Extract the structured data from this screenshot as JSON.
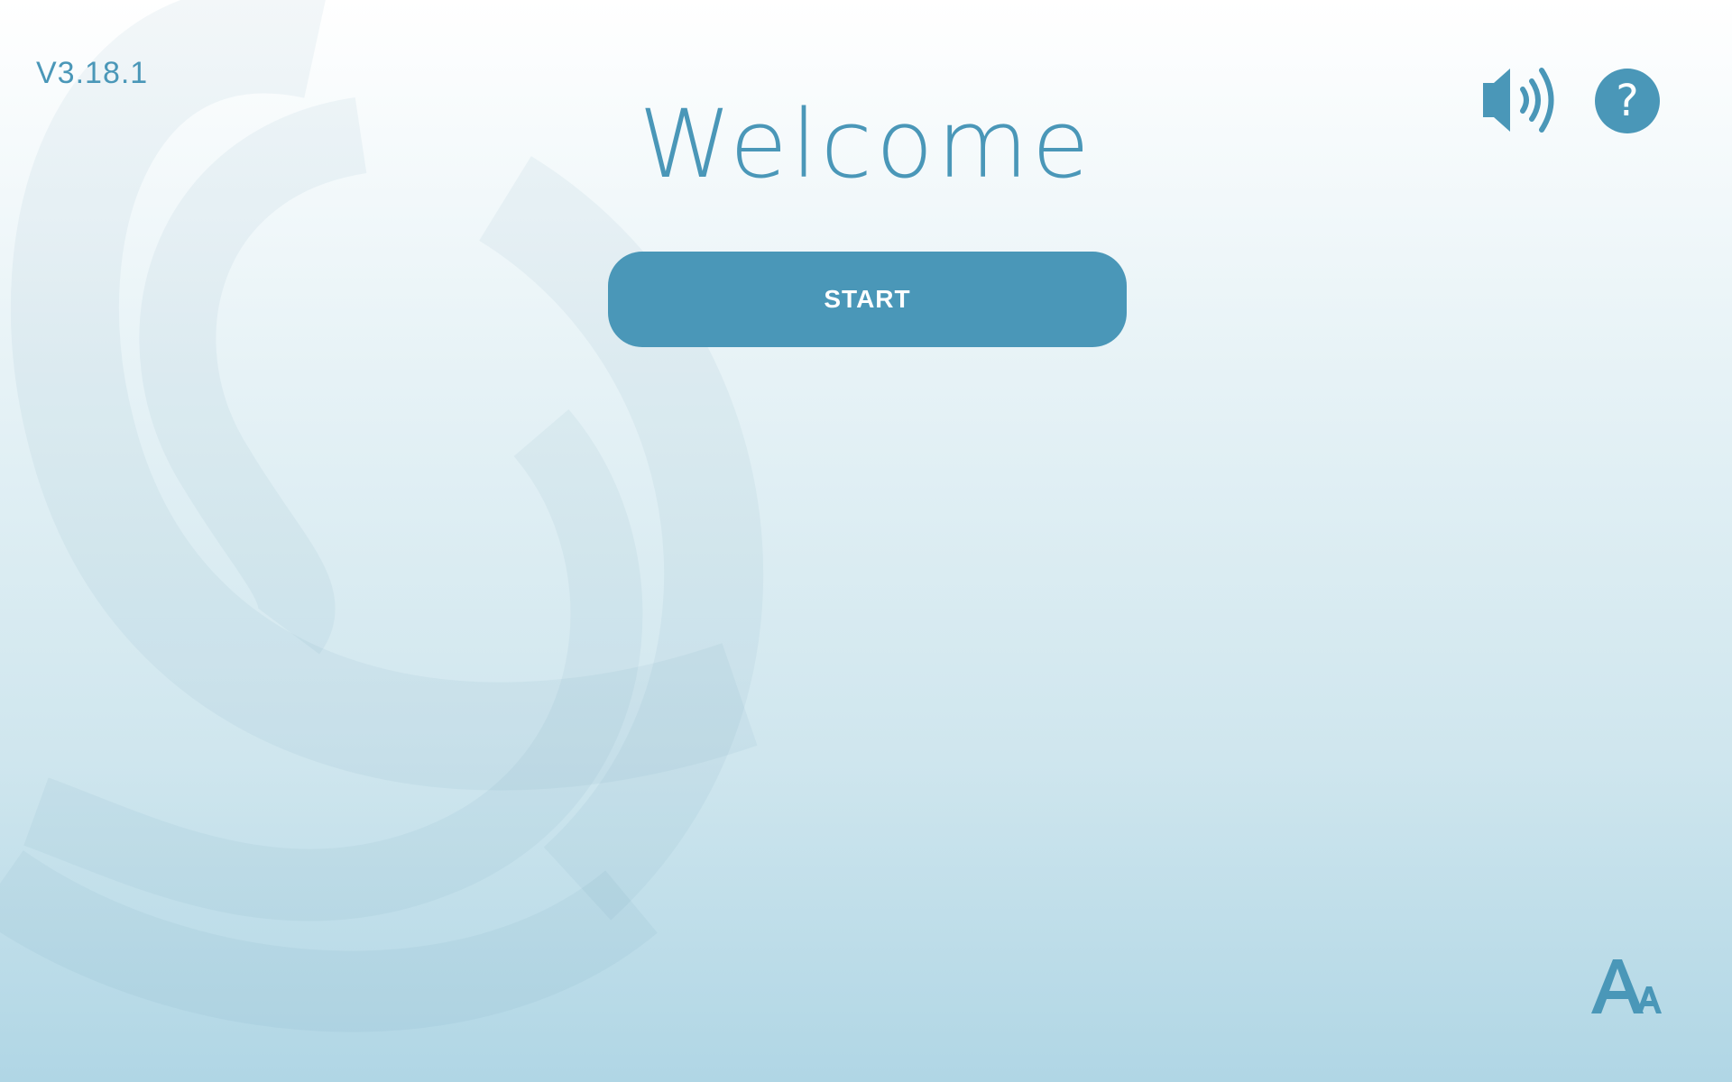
{
  "version": "V3.18.1",
  "title": "Welcome",
  "start_label": "START",
  "help_symbol": "?",
  "icons": {
    "sound": "speaker-volume-icon",
    "help": "help-icon",
    "font_size": "text-size-icon",
    "background": "logo-watermark"
  },
  "colors": {
    "accent": "#4a97b8",
    "button_text": "#ffffff",
    "background_top": "#ffffff",
    "background_bottom": "#b0d6e5"
  }
}
